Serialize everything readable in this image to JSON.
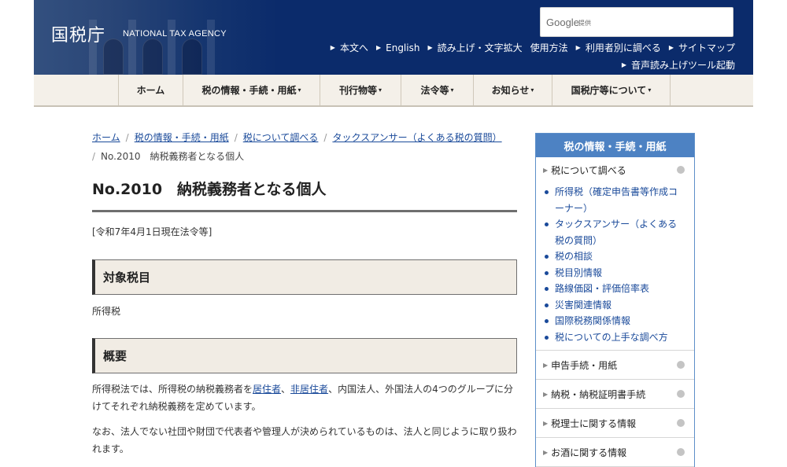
{
  "header": {
    "logo_jp": "国税庁",
    "logo_en": "NATIONAL TAX AGENCY",
    "search": {
      "brand": "Google",
      "powered_label": "提供"
    },
    "util_links_row1": [
      "本文へ",
      "English",
      "読み上げ・文字拡大",
      "使用方法",
      "利用者別に調べる",
      "サイトマップ"
    ],
    "util_links_row2": [
      "音声読み上げツール起動"
    ]
  },
  "nav": {
    "items": [
      {
        "label": "ホーム",
        "dropdown": false
      },
      {
        "label": "税の情報・手続・用紙",
        "dropdown": true
      },
      {
        "label": "刊行物等",
        "dropdown": true
      },
      {
        "label": "法令等",
        "dropdown": true
      },
      {
        "label": "お知らせ",
        "dropdown": true
      },
      {
        "label": "国税庁等について",
        "dropdown": true
      }
    ]
  },
  "breadcrumb": {
    "links": [
      "ホーム",
      "税の情報・手続・用紙",
      "税について調べる",
      "タックスアンサー（よくある税の質問）"
    ],
    "current": "No.2010　納税義務者となる個人"
  },
  "main": {
    "title": "No.2010　納税義務者となる個人",
    "as_of": "[令和7年4月1日現在法令等]",
    "section1_heading": "対象税目",
    "tax_item": "所得税",
    "section2_heading": "概要",
    "para1": {
      "pre": "所得税法では、所得税の納税義務者を",
      "link1": "居住者",
      "mid": "、",
      "link2": "非居住者",
      "post": "、内国法人、外国法人の4つのグループに分けてそれぞれ納税義務を定めています。"
    },
    "para2": "なお、法人でない社団や財団で代表者や管理人が決められているものは、法人と同じように取り扱われます。"
  },
  "sidebar": {
    "header": "税の情報・手続・用紙",
    "current_section": "税について調べる",
    "sub_items": [
      "所得税（確定申告書等作成コーナー）",
      "タックスアンサー（よくある税の質問）",
      "税の相談",
      "税目別情報",
      "路線価図・評価倍率表",
      "災害関連情報",
      "国際税務関係情報",
      "税についての上手な調べ方"
    ],
    "other_sections": [
      "申告手続・用紙",
      "納税・納税証明書手続",
      "税理士に関する情報",
      "お酒に関する情報"
    ]
  },
  "colors": {
    "header_bg": "#0b2b6b",
    "nav_bg": "#f4f0e9",
    "link": "#1a4a9a",
    "sidebar_header": "#4d82c3",
    "section_box_bg": "#f1ece4"
  }
}
